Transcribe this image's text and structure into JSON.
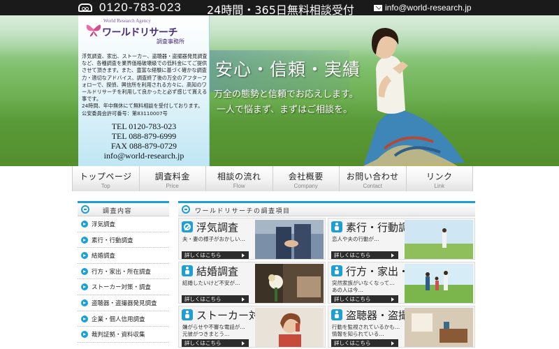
{
  "topbar": {
    "phone": "0120-783-023",
    "hours": "24時間・365日無料相談受付",
    "email": "info@world-research.jp"
  },
  "brand": {
    "sub": "World Research Agency",
    "name": "ワールドリサーチ",
    "tag": "調査事務所"
  },
  "intro": {
    "text": "浮気調査、家出、ストーカー、盗聴器・盗撮器発見調査など、各種調査を業界価格破壊級での低料金にてご提供させて頂きます。また、豊富な経験に基づく確かな調査力・適切なアドバイス、調査終了後の万全のアフターフォローで、探偵、興信所を利用される方々に、高知のワールドリサーチを利用して良かったと必ず感じて貰える事です。",
    "hours_note": "24時間、年中無休にて無料相談を受付しております。",
    "license": "公安委員会許可番号：第83110007号"
  },
  "contacts": {
    "tel1": "TEL 0120-783-023",
    "tel2": "TEL 088-879-6999",
    "fax": "FAX 088-879-0729",
    "email": "info@world-research.jp"
  },
  "hero": {
    "title": "安心・信頼・実績",
    "line1": "万全の態勢と信頼でお応えします。",
    "line2": "一人で悩まず、まずはご相談を。"
  },
  "nav": [
    {
      "jp": "トップページ",
      "en": "Top"
    },
    {
      "jp": "調査料金",
      "en": "Price"
    },
    {
      "jp": "相談の流れ",
      "en": "Flow"
    },
    {
      "jp": "会社概要",
      "en": "Company"
    },
    {
      "jp": "お問い合わせ",
      "en": "Contact"
    },
    {
      "jp": "リンク",
      "en": "Link"
    }
  ],
  "sidebar": {
    "title": "調査内容",
    "items": [
      {
        "label": "浮気調査"
      },
      {
        "label": "素行・行動調査"
      },
      {
        "label": "結婚調査"
      },
      {
        "label": "行方・家出・所在調査"
      },
      {
        "label": "ストーカー対策・調査"
      },
      {
        "label": "盗聴器・盗撮器発見調査"
      },
      {
        "label": "企業・個人信用調査"
      },
      {
        "label": "裁判証拠・資料収集"
      }
    ]
  },
  "main": {
    "title": "ワールドリサーチの調査項目",
    "more_label": "詳しくはこちら",
    "cards": [
      {
        "title": "浮気調査",
        "desc": "夫・妻の様子がおかしい…",
        "icon": "no-entry-icon"
      },
      {
        "title": "素行・行動調査",
        "desc": "恋人や夫の行動が…",
        "icon": "person-icon"
      },
      {
        "title": "結婚調査",
        "desc": "結婚したいけど不安が…",
        "icon": "person-icon"
      },
      {
        "title": "行方・家出・所在調査",
        "desc": "突然家族がいなくなって…\nあの人は今…",
        "icon": "person-icon"
      },
      {
        "title": "ストーカー対策・調査",
        "desc": "嫌がらせや不審な電話が…\n元彼がつきまとう…",
        "icon": "person-icon"
      },
      {
        "title": "盗聴器・盗撮器発見調査",
        "desc": "行動を監視されているかも…\n情報を知られている…",
        "icon": "phone-icon"
      }
    ]
  },
  "colors": {
    "accent": "#1d9fd5",
    "topbar": "#1a1a1a",
    "brand": "#4b2e7a"
  }
}
